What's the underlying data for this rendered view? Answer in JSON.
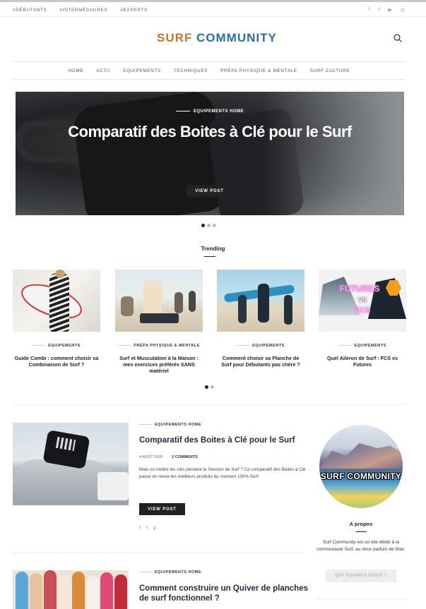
{
  "topbar": {
    "tags": [
      "#DÉBUTANTS",
      "#INTERMÉDIAIRES",
      "#EXPERTS"
    ],
    "socials": [
      "f",
      "t",
      "▶",
      "◎"
    ]
  },
  "brand": {
    "word1": "SURF",
    "word2": "COMMUNITY"
  },
  "nav": [
    "HOME",
    "ACTU",
    "EQUIPEMENTS",
    "TECHNIQUES",
    "PRÉPA PHYSIQUE & MENTALE",
    "SURF CULTURE"
  ],
  "hero": {
    "categories": "EQUIPEMENTS   HOME",
    "title": "Comparatif des Boites à Clé pour le Surf",
    "button": "VIEW POST"
  },
  "trending": {
    "heading": "Trending",
    "cards": [
      {
        "category": "EQUIPEMENTS",
        "title": "Guide Combi : comment choisir sa Combinaison de Surf ?"
      },
      {
        "category": "PRÉPA PHYSIQUE & MENTALE",
        "title": "Surf et Musculation à la Maison : mes exercices préférés SANS matériel"
      },
      {
        "category": "EQUIPEMENTS",
        "title": "Comment choisir sa Planche de Surf pour Débutants pas chère ?"
      },
      {
        "category": "EQUIPEMENTS",
        "title": "Quel Aileron de Surf : FCS vs Futures"
      }
    ]
  },
  "posts": [
    {
      "categories": "EQUIPEMENTS   HOME",
      "title": "Comparatif des Boites à Clé pour le Surf",
      "date": "4 AOÛT 2020",
      "comments": "2 COMMENTS",
      "excerpt": "Mais où mettre les clés pendant la Session de Surf ? Ce comparatif des Boites à Clé passe en revue les meilleurs produits du moment 100% Surf.",
      "button": "VIEW POST",
      "share": [
        "f",
        "t",
        "p"
      ]
    },
    {
      "categories": "EQUIPEMENTS   HOME",
      "title": "Comment construire un Quiver de planches de surf fonctionnel ?"
    }
  ],
  "sidebar": {
    "avatar_text": "SURF COMMUNITY",
    "heading": "A propos",
    "text": "Surf Community est un site dédié à la communauté Surf, au doux parfum de Wax.",
    "button": "QUI SOMMES NOUS ?"
  },
  "colors": {
    "accent_orange": "#c9722e",
    "accent_blue": "#2c6f9e",
    "dark": "#222222"
  }
}
